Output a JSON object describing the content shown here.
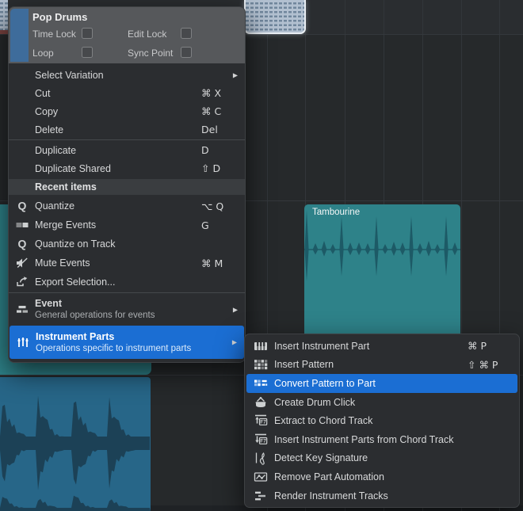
{
  "colors": {
    "accent_highlight": "#1b6ed3",
    "menu_background": "#2b2d30",
    "menu_header_background": "#56585b",
    "track_color_strip": "#3e6c9b",
    "teal_clip": "#2e8289",
    "teal_waveform": "#1d5a66",
    "blue_clip": "#276688",
    "blue_waveform": "#1c4156",
    "pattern_clip": "#b2c0d0",
    "arrange_background": "#26292b"
  },
  "arrangement": {
    "clips": [
      {
        "label": "Tambourine"
      }
    ]
  },
  "context_menu": {
    "header": {
      "title": "Pop Drums",
      "checkboxes": [
        {
          "label": "Time Lock",
          "checked": false
        },
        {
          "label": "Edit Lock",
          "checked": false
        },
        {
          "label": "Loop",
          "checked": false
        },
        {
          "label": "Sync Point",
          "checked": false
        }
      ]
    },
    "items": [
      {
        "type": "item",
        "label": "Select Variation",
        "submenu": true
      },
      {
        "type": "item",
        "label": "Cut",
        "shortcut": "⌘ X"
      },
      {
        "type": "item",
        "label": "Copy",
        "shortcut": "⌘ C"
      },
      {
        "type": "item",
        "label": "Delete",
        "shortcut": "Del"
      },
      {
        "type": "separator"
      },
      {
        "type": "item",
        "label": "Duplicate",
        "shortcut": "D"
      },
      {
        "type": "item",
        "label": "Duplicate Shared",
        "shortcut": "⇧ D"
      },
      {
        "type": "section",
        "label": "Recent items"
      },
      {
        "type": "item",
        "icon": "quantize",
        "label": "Quantize",
        "shortcut": "⌥ Q"
      },
      {
        "type": "item",
        "icon": "merge-events",
        "label": "Merge Events",
        "shortcut": "G"
      },
      {
        "type": "item",
        "icon": "quantize",
        "label": "Quantize on Track"
      },
      {
        "type": "item",
        "icon": "mute",
        "label": "Mute Events",
        "shortcut": "⌘ M"
      },
      {
        "type": "item",
        "icon": "export",
        "label": "Export Selection..."
      },
      {
        "type": "separator"
      },
      {
        "type": "dual",
        "icon": "event",
        "label": "Event",
        "subtitle": "General operations for events",
        "submenu": true
      },
      {
        "type": "dual",
        "icon": "instrument-parts",
        "label": "Instrument Parts",
        "subtitle": "Operations specific to instrument parts",
        "submenu": true,
        "highlighted": true
      }
    ],
    "submenu_items": [
      {
        "icon": "piano",
        "label": "Insert Instrument Part",
        "shortcut": "⌘ P"
      },
      {
        "icon": "pattern-grid",
        "label": "Insert Pattern",
        "shortcut": "⇧ ⌘ P"
      },
      {
        "icon": "convert-pattern",
        "label": "Convert Pattern to Part",
        "highlighted": true
      },
      {
        "icon": "drum",
        "label": "Create Drum Click"
      },
      {
        "icon": "extract-chord",
        "label": "Extract to Chord Track"
      },
      {
        "icon": "insert-chord",
        "label": "Insert Instrument Parts from Chord Track"
      },
      {
        "icon": "key-signature",
        "label": "Detect Key Signature"
      },
      {
        "icon": "automation",
        "label": "Remove Part Automation"
      },
      {
        "icon": "render-tracks",
        "label": "Render Instrument Tracks"
      }
    ]
  }
}
